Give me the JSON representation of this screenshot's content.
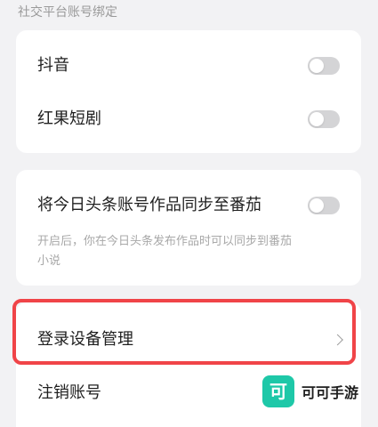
{
  "social_binding": {
    "section_title": "社交平台账号绑定",
    "items": [
      {
        "label": "抖音",
        "toggle_on": false
      },
      {
        "label": "红果短剧",
        "toggle_on": false
      }
    ]
  },
  "sync": {
    "label": "将今日头条账号作品同步至番茄",
    "toggle_on": false,
    "description": "开启后，你在今日头条发布作品时可以同步到番茄小说"
  },
  "account": {
    "login_devices_label": "登录设备管理",
    "deactivate_label": "注销账号"
  },
  "watermark": {
    "logo_glyph": "可",
    "text": "可可手游",
    "color": "#1ec8a8"
  },
  "colors": {
    "highlight": "#f04448",
    "toggle_off": "#d4d4d6"
  }
}
